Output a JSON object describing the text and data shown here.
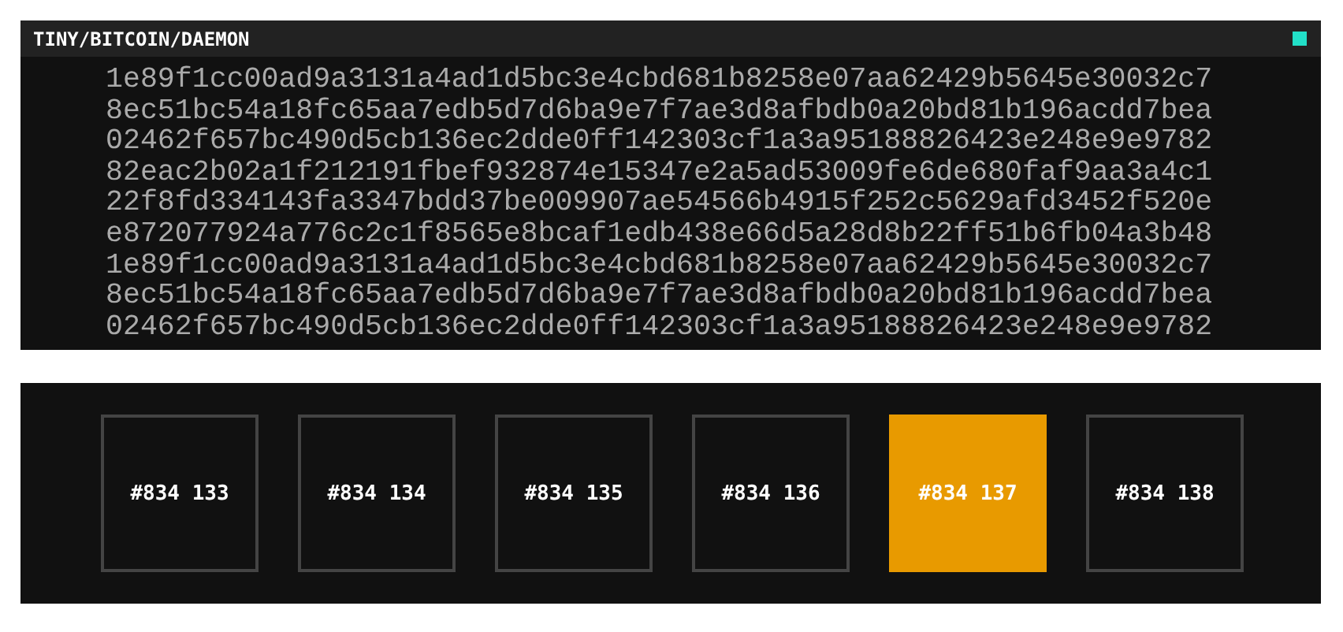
{
  "window": {
    "title": "TINY/BITCOIN/DAEMON"
  },
  "hashes": [
    "1e89f1cc00ad9a3131a4ad1d5bc3e4cbd681b8258e07aa62429b5645e30032c7",
    "8ec51bc54a18fc65aa7edb5d7d6ba9e7f7ae3d8afbdb0a20bd81b196acdd7bea",
    "02462f657bc490d5cb136ec2dde0ff142303cf1a3a95188826423e248e9e9782",
    "82eac2b02a1f212191fbef932874e15347e2a5ad53009fe6de680faf9aa3a4c1",
    "22f8fd334143fa3347bdd37be009907ae54566b4915f252c5629afd3452f520e",
    "e872077924a776c2c1f8565e8bcaf1edb438e66d5a28d8b22ff51b6fb04a3b48",
    "1e89f1cc00ad9a3131a4ad1d5bc3e4cbd681b8258e07aa62429b5645e30032c7",
    "8ec51bc54a18fc65aa7edb5d7d6ba9e7f7ae3d8afbdb0a20bd81b196acdd7bea",
    "02462f657bc490d5cb136ec2dde0ff142303cf1a3a95188826423e248e9e9782"
  ],
  "blocks": [
    {
      "label": "#834 133",
      "selected": false
    },
    {
      "label": "#834 134",
      "selected": false
    },
    {
      "label": "#834 135",
      "selected": false
    },
    {
      "label": "#834 136",
      "selected": false
    },
    {
      "label": "#834 137",
      "selected": true
    },
    {
      "label": "#834 138",
      "selected": false
    }
  ]
}
